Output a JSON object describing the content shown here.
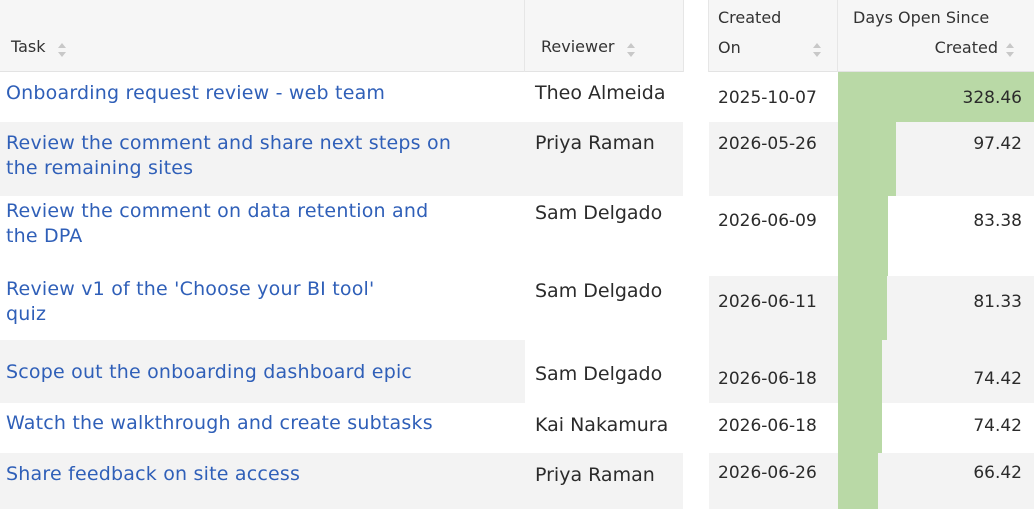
{
  "columns": {
    "task": "Task",
    "reviewer": "Reviewer",
    "created_line1": "Created",
    "created_line2": "On",
    "days_line1": "Days Open Since",
    "days_line2": "Created"
  },
  "max_days": 328.46,
  "rows": [
    {
      "task_line1": "Onboarding request review - web team",
      "task_line2": "",
      "reviewer": "Theo Almeida",
      "created_on": "2025-10-07",
      "days_open": 328.46,
      "days_label": "328.46"
    },
    {
      "task_line1": "Review the comment and share next steps on",
      "task_line2": "the remaining sites",
      "reviewer": "Priya Raman",
      "created_on": "2026-05-26",
      "days_open": 97.42,
      "days_label": "97.42"
    },
    {
      "task_line1": "Review the comment on data retention and",
      "task_line2": "the DPA",
      "reviewer": "Sam Delgado",
      "created_on": "2026-06-09",
      "days_open": 83.38,
      "days_label": "83.38"
    },
    {
      "task_line1": "Review v1 of the 'Choose your BI tool'",
      "task_line2": "quiz",
      "reviewer": "Sam Delgado",
      "created_on": "2026-06-11",
      "days_open": 81.33,
      "days_label": "81.33"
    },
    {
      "task_line1": "Scope out the onboarding dashboard epic",
      "task_line2": "",
      "reviewer": "Sam Delgado",
      "created_on": "2026-06-18",
      "days_open": 74.42,
      "days_label": "74.42"
    },
    {
      "task_line1": "Watch the walkthrough and create subtasks",
      "task_line2": "",
      "reviewer": "Kai Nakamura",
      "created_on": "2026-06-18",
      "days_open": 74.42,
      "days_label": "74.42"
    },
    {
      "task_line1": "Share feedback on site access",
      "task_line2": "",
      "reviewer": "Priya Raman",
      "created_on": "2026-06-26",
      "days_open": 66.42,
      "days_label": "66.42"
    }
  ]
}
